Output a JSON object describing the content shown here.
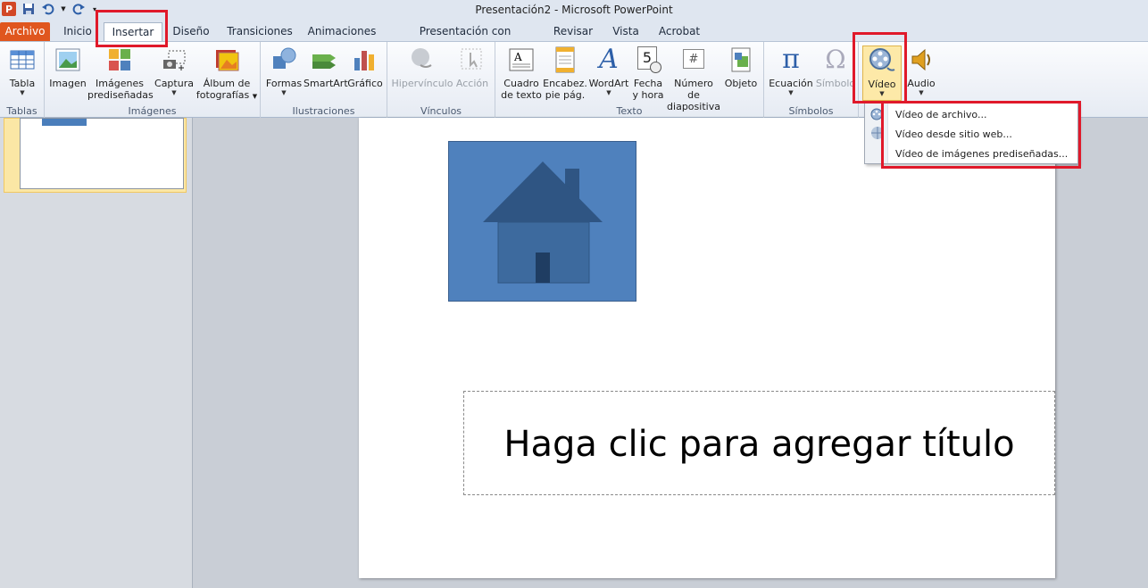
{
  "window": {
    "title": "Presentación2  -  Microsoft PowerPoint"
  },
  "quick_access": {
    "logo": "P"
  },
  "tabs": [
    {
      "label": "Archivo"
    },
    {
      "label": "Inicio"
    },
    {
      "label": "Insertar"
    },
    {
      "label": "Diseño"
    },
    {
      "label": "Transiciones"
    },
    {
      "label": "Animaciones"
    },
    {
      "label": "Presentación con diapositivas"
    },
    {
      "label": "Revisar"
    },
    {
      "label": "Vista"
    },
    {
      "label": "Acrobat"
    }
  ],
  "ribbon": {
    "groups": {
      "tablas": "Tablas",
      "imagenes": "Imágenes",
      "ilustraciones": "Ilustraciones",
      "vinculos": "Vínculos",
      "texto": "Texto",
      "simbolos": "Símbolos"
    },
    "buttons": {
      "tabla": "Tabla",
      "imagen": "Imagen",
      "imagenes_pred_1": "Imágenes",
      "imagenes_pred_2": "prediseñadas",
      "captura": "Captura",
      "album_1": "Álbum de",
      "album_2": "fotografías",
      "formas": "Formas",
      "smartart": "SmartArt",
      "grafico": "Gráfico",
      "hipervinculo": "Hipervínculo",
      "accion": "Acción",
      "cuadro_1": "Cuadro",
      "cuadro_2": "de texto",
      "encabez_1": "Encabez.",
      "encabez_2": "pie pág.",
      "wordart": "WordArt",
      "fecha_1": "Fecha",
      "fecha_2": "y hora",
      "numero_1": "Número de",
      "numero_2": "diapositiva",
      "objeto": "Objeto",
      "ecuacion": "Ecuación",
      "simbolo": "Símbolo",
      "video": "Vídeo",
      "audio": "Audio"
    },
    "glyphs": {
      "wordart": "A",
      "fecha": "5",
      "numero": "#",
      "pi": "π",
      "omega": "Ω"
    }
  },
  "video_menu": {
    "items": [
      {
        "label": "Vídeo de archivo..."
      },
      {
        "label": "Vídeo desde sitio web..."
      },
      {
        "label": "Vídeo de imágenes prediseñadas..."
      }
    ]
  },
  "slide": {
    "title_placeholder": "Haga clic para agregar título"
  },
  "colors": {
    "file_tab": "#e0561e",
    "highlight": "#e0192a",
    "picture_fill": "#4f81bd"
  }
}
